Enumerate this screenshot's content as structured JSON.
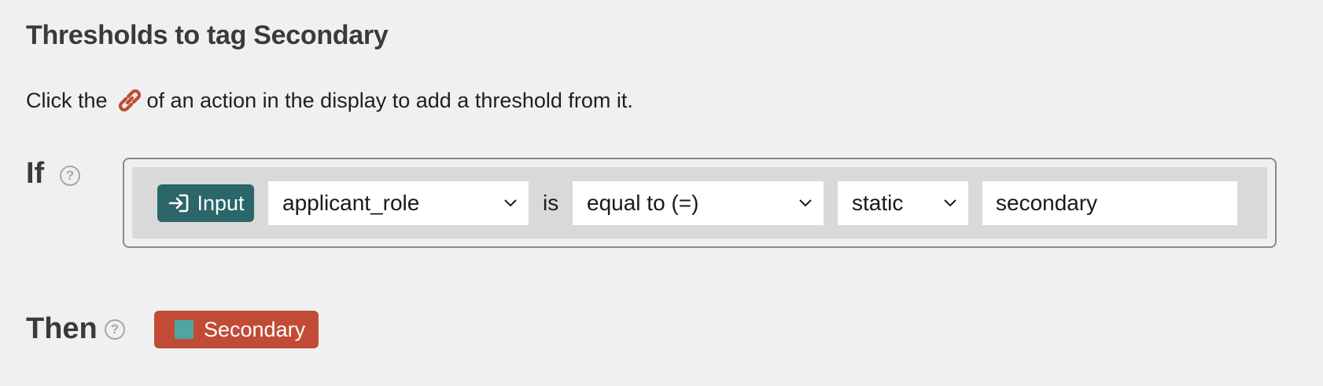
{
  "header": {
    "title": "Thresholds to tag Secondary"
  },
  "hint": {
    "before": "Click the",
    "after": "of an action in the display to add a threshold from it.",
    "icon": "link-icon"
  },
  "condition": {
    "label": "If",
    "help": "?",
    "source_badge": {
      "label": "Input",
      "icon": "input-arrow-icon"
    },
    "field_select": {
      "value": "applicant_role"
    },
    "connector": "is",
    "operator_select": {
      "value": "equal to (=)"
    },
    "mode_select": {
      "value": "static"
    },
    "value_input": {
      "value": "secondary"
    }
  },
  "action": {
    "label": "Then",
    "help": "?",
    "tag": {
      "label": "Secondary"
    }
  },
  "colors": {
    "background": "#f0f0f0",
    "input_badge": "#2b6669",
    "tag_pill": "#c14b35",
    "tag_swatch": "#4ea6a3",
    "link_icon": "#c14b35"
  }
}
